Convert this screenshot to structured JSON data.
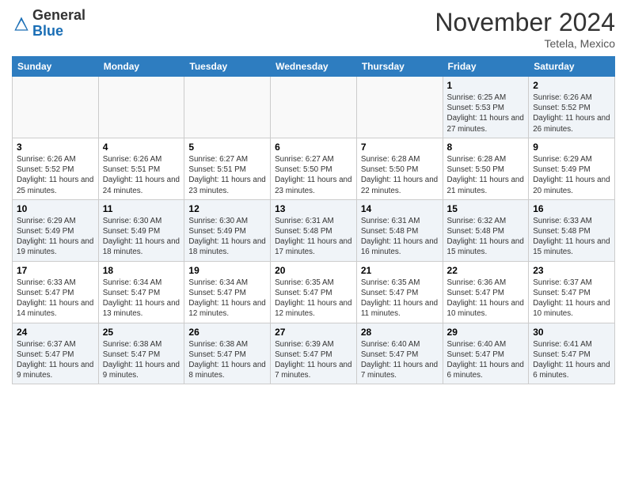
{
  "header": {
    "logo_general": "General",
    "logo_blue": "Blue",
    "month_title": "November 2024",
    "location": "Tetela, Mexico"
  },
  "weekdays": [
    "Sunday",
    "Monday",
    "Tuesday",
    "Wednesday",
    "Thursday",
    "Friday",
    "Saturday"
  ],
  "weeks": [
    [
      {
        "day": "",
        "info": ""
      },
      {
        "day": "",
        "info": ""
      },
      {
        "day": "",
        "info": ""
      },
      {
        "day": "",
        "info": ""
      },
      {
        "day": "",
        "info": ""
      },
      {
        "day": "1",
        "info": "Sunrise: 6:25 AM\nSunset: 5:53 PM\nDaylight: 11 hours and 27 minutes."
      },
      {
        "day": "2",
        "info": "Sunrise: 6:26 AM\nSunset: 5:52 PM\nDaylight: 11 hours and 26 minutes."
      }
    ],
    [
      {
        "day": "3",
        "info": "Sunrise: 6:26 AM\nSunset: 5:52 PM\nDaylight: 11 hours and 25 minutes."
      },
      {
        "day": "4",
        "info": "Sunrise: 6:26 AM\nSunset: 5:51 PM\nDaylight: 11 hours and 24 minutes."
      },
      {
        "day": "5",
        "info": "Sunrise: 6:27 AM\nSunset: 5:51 PM\nDaylight: 11 hours and 23 minutes."
      },
      {
        "day": "6",
        "info": "Sunrise: 6:27 AM\nSunset: 5:50 PM\nDaylight: 11 hours and 23 minutes."
      },
      {
        "day": "7",
        "info": "Sunrise: 6:28 AM\nSunset: 5:50 PM\nDaylight: 11 hours and 22 minutes."
      },
      {
        "day": "8",
        "info": "Sunrise: 6:28 AM\nSunset: 5:50 PM\nDaylight: 11 hours and 21 minutes."
      },
      {
        "day": "9",
        "info": "Sunrise: 6:29 AM\nSunset: 5:49 PM\nDaylight: 11 hours and 20 minutes."
      }
    ],
    [
      {
        "day": "10",
        "info": "Sunrise: 6:29 AM\nSunset: 5:49 PM\nDaylight: 11 hours and 19 minutes."
      },
      {
        "day": "11",
        "info": "Sunrise: 6:30 AM\nSunset: 5:49 PM\nDaylight: 11 hours and 18 minutes."
      },
      {
        "day": "12",
        "info": "Sunrise: 6:30 AM\nSunset: 5:49 PM\nDaylight: 11 hours and 18 minutes."
      },
      {
        "day": "13",
        "info": "Sunrise: 6:31 AM\nSunset: 5:48 PM\nDaylight: 11 hours and 17 minutes."
      },
      {
        "day": "14",
        "info": "Sunrise: 6:31 AM\nSunset: 5:48 PM\nDaylight: 11 hours and 16 minutes."
      },
      {
        "day": "15",
        "info": "Sunrise: 6:32 AM\nSunset: 5:48 PM\nDaylight: 11 hours and 15 minutes."
      },
      {
        "day": "16",
        "info": "Sunrise: 6:33 AM\nSunset: 5:48 PM\nDaylight: 11 hours and 15 minutes."
      }
    ],
    [
      {
        "day": "17",
        "info": "Sunrise: 6:33 AM\nSunset: 5:47 PM\nDaylight: 11 hours and 14 minutes."
      },
      {
        "day": "18",
        "info": "Sunrise: 6:34 AM\nSunset: 5:47 PM\nDaylight: 11 hours and 13 minutes."
      },
      {
        "day": "19",
        "info": "Sunrise: 6:34 AM\nSunset: 5:47 PM\nDaylight: 11 hours and 12 minutes."
      },
      {
        "day": "20",
        "info": "Sunrise: 6:35 AM\nSunset: 5:47 PM\nDaylight: 11 hours and 12 minutes."
      },
      {
        "day": "21",
        "info": "Sunrise: 6:35 AM\nSunset: 5:47 PM\nDaylight: 11 hours and 11 minutes."
      },
      {
        "day": "22",
        "info": "Sunrise: 6:36 AM\nSunset: 5:47 PM\nDaylight: 11 hours and 10 minutes."
      },
      {
        "day": "23",
        "info": "Sunrise: 6:37 AM\nSunset: 5:47 PM\nDaylight: 11 hours and 10 minutes."
      }
    ],
    [
      {
        "day": "24",
        "info": "Sunrise: 6:37 AM\nSunset: 5:47 PM\nDaylight: 11 hours and 9 minutes."
      },
      {
        "day": "25",
        "info": "Sunrise: 6:38 AM\nSunset: 5:47 PM\nDaylight: 11 hours and 9 minutes."
      },
      {
        "day": "26",
        "info": "Sunrise: 6:38 AM\nSunset: 5:47 PM\nDaylight: 11 hours and 8 minutes."
      },
      {
        "day": "27",
        "info": "Sunrise: 6:39 AM\nSunset: 5:47 PM\nDaylight: 11 hours and 7 minutes."
      },
      {
        "day": "28",
        "info": "Sunrise: 6:40 AM\nSunset: 5:47 PM\nDaylight: 11 hours and 7 minutes."
      },
      {
        "day": "29",
        "info": "Sunrise: 6:40 AM\nSunset: 5:47 PM\nDaylight: 11 hours and 6 minutes."
      },
      {
        "day": "30",
        "info": "Sunrise: 6:41 AM\nSunset: 5:47 PM\nDaylight: 11 hours and 6 minutes."
      }
    ]
  ]
}
